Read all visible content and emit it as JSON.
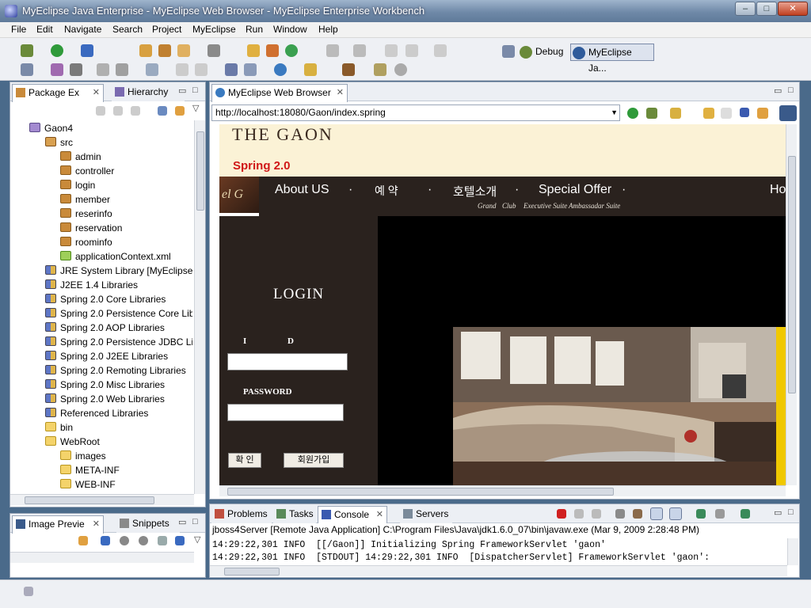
{
  "window": {
    "title": "MyEclipse Java Enterprise - MyEclipse Web Browser - MyEclipse Enterprise Workbench",
    "minimize": "–",
    "maximize": "□",
    "close": "✕"
  },
  "menu": [
    "File",
    "Edit",
    "Navigate",
    "Search",
    "Project",
    "MyEclipse",
    "Run",
    "Window",
    "Help"
  ],
  "perspectives": {
    "debug": "Debug",
    "myeclipse": "MyEclipse Ja..."
  },
  "package_explorer": {
    "tabs": [
      "Package Ex",
      "Hierarchy"
    ],
    "tree": [
      {
        "label": "Gaon4",
        "icon": "project-icon"
      },
      {
        "label": "src",
        "icon": "src-folder-icon"
      },
      {
        "label": "admin",
        "icon": "package-icon"
      },
      {
        "label": "controller",
        "icon": "package-icon"
      },
      {
        "label": "login",
        "icon": "package-icon"
      },
      {
        "label": "member",
        "icon": "package-icon"
      },
      {
        "label": "reserinfo",
        "icon": "package-icon"
      },
      {
        "label": "reservation",
        "icon": "package-icon"
      },
      {
        "label": "roominfo",
        "icon": "package-icon"
      },
      {
        "label": "applicationContext.xml",
        "icon": "xml-file-icon"
      },
      {
        "label": "JRE System Library [MyEclipse",
        "icon": "library-icon"
      },
      {
        "label": "J2EE 1.4 Libraries",
        "icon": "library-icon"
      },
      {
        "label": "Spring 2.0 Core Libraries",
        "icon": "library-icon"
      },
      {
        "label": "Spring 2.0 Persistence Core Lib",
        "icon": "library-icon"
      },
      {
        "label": "Spring 2.0 AOP Libraries",
        "icon": "library-icon"
      },
      {
        "label": "Spring 2.0 Persistence JDBC Li",
        "icon": "library-icon"
      },
      {
        "label": "Spring 2.0 J2EE Libraries",
        "icon": "library-icon"
      },
      {
        "label": "Spring 2.0 Remoting Libraries",
        "icon": "library-icon"
      },
      {
        "label": "Spring 2.0 Misc Libraries",
        "icon": "library-icon"
      },
      {
        "label": "Spring 2.0 Web Libraries",
        "icon": "library-icon"
      },
      {
        "label": "Referenced Libraries",
        "icon": "library-icon"
      },
      {
        "label": "bin",
        "icon": "folder-icon"
      },
      {
        "label": "WebRoot",
        "icon": "folder-icon"
      },
      {
        "label": "images",
        "icon": "folder-icon"
      },
      {
        "label": "META-INF",
        "icon": "folder-icon"
      },
      {
        "label": "WEB-INF",
        "icon": "folder-icon"
      }
    ]
  },
  "image_preview": {
    "tabs": [
      "Image Previe",
      "Snippets"
    ]
  },
  "browser": {
    "tab": "MyEclipse Web Browser",
    "url": "http://localhost:18080/Gaon/index.spring"
  },
  "webpage": {
    "logo": "THE GAON",
    "subtitle": "Spring 2.0",
    "logo_badge": "el G",
    "nav": [
      "About US",
      "예 약",
      "호텔소개",
      "Special Offer",
      "Ho"
    ],
    "nav_dot": "·",
    "nav_sub": [
      "Grand",
      "Club",
      "Executive Suite",
      "Ambassadar Suite"
    ],
    "login_title": "LOGIN",
    "id_label_i": "I",
    "id_label_d": "D",
    "password_label": "PASSWORD",
    "confirm_button": "확 인",
    "signup_button": "회원가입"
  },
  "console": {
    "tabs": [
      "Problems",
      "Tasks",
      "Console",
      "Servers"
    ],
    "header": "jboss4Server [Remote Java Application] C:\\Program Files\\Java\\jdk1.6.0_07\\bin\\javaw.exe (Mar 9, 2009 2:28:48 PM)",
    "lines": [
      "14:29:22,301 INFO  [[/Gaon]] Initializing Spring FrameworkServlet 'gaon'",
      "14:29:22,301 INFO  [STDOUT] 14:29:22,301 INFO  [DispatcherServlet] FrameworkServlet 'gaon':"
    ]
  },
  "colors": {
    "accent": "#2f5b9b",
    "web_dark": "#2a221e",
    "web_cream": "#fbf2d6",
    "web_red": "#d01818"
  }
}
